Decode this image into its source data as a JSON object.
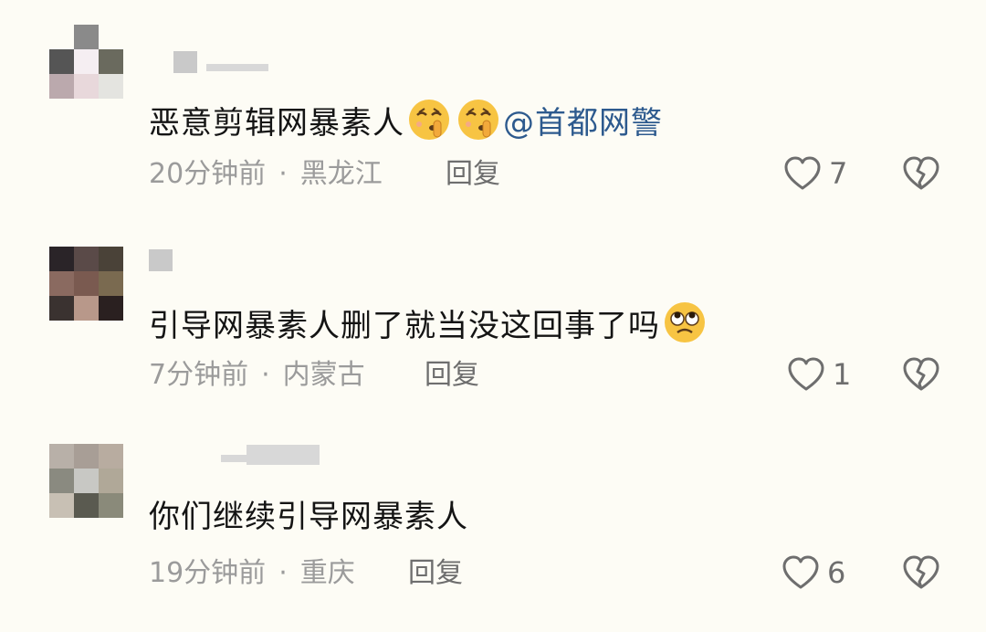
{
  "comments": [
    {
      "text": "恶意剪辑网暴素人",
      "mention": "@首都网警",
      "time": "20分钟前",
      "location": "黑龙江",
      "reply": "回复",
      "likes": "7",
      "emojis": [
        "shush-emoji",
        "shush-emoji"
      ]
    },
    {
      "text": "引导网暴素人删了就当没这回事了吗",
      "mention": "",
      "time": "7分钟前",
      "location": "内蒙古",
      "reply": "回复",
      "likes": "1",
      "emojis": [
        "rolling-eyes-emoji"
      ]
    },
    {
      "text": "你们继续引导网暴素人",
      "mention": "",
      "time": "19分钟前",
      "location": "重庆",
      "reply": "回复",
      "likes": "6",
      "emojis": []
    }
  ],
  "separator": "·",
  "colors": {
    "background": "#fdfcf5",
    "text": "#141414",
    "meta": "#9b9b9b",
    "mention": "#2d5a8e",
    "icon": "#6e6e6e"
  }
}
